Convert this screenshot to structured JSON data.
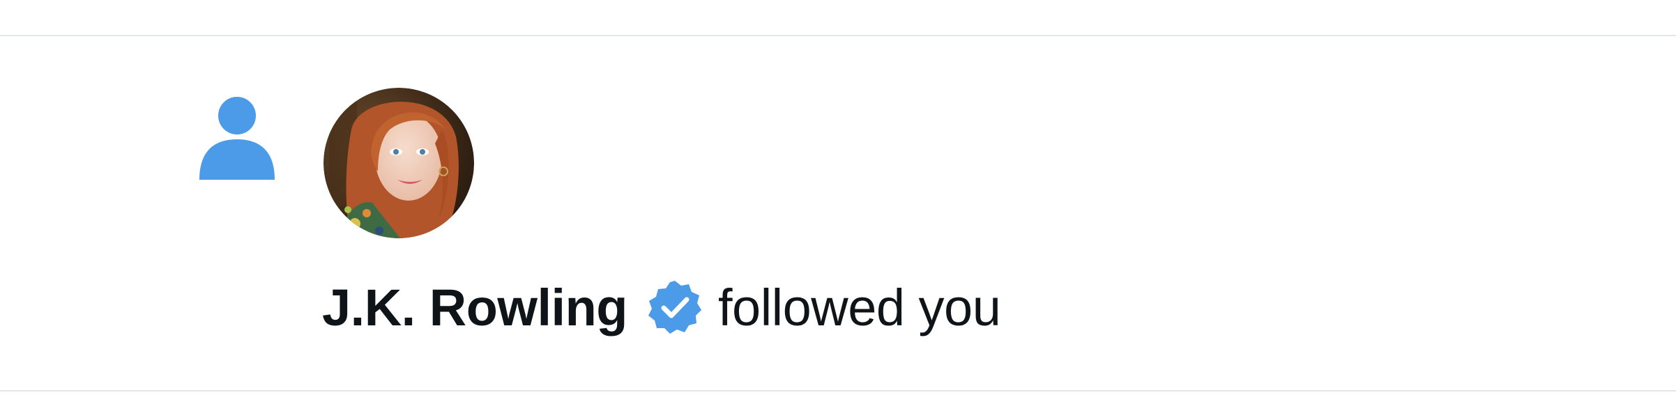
{
  "notification": {
    "type_icon": "person-icon",
    "avatar": "profile-photo",
    "user_name": "J.K. Rowling",
    "verified_icon": "verified-badge-icon",
    "action_text": "followed you"
  },
  "colors": {
    "accent": "#4c9be8",
    "text": "#0f1419",
    "divider": "#e3e6e8",
    "background": "#ffffff"
  }
}
